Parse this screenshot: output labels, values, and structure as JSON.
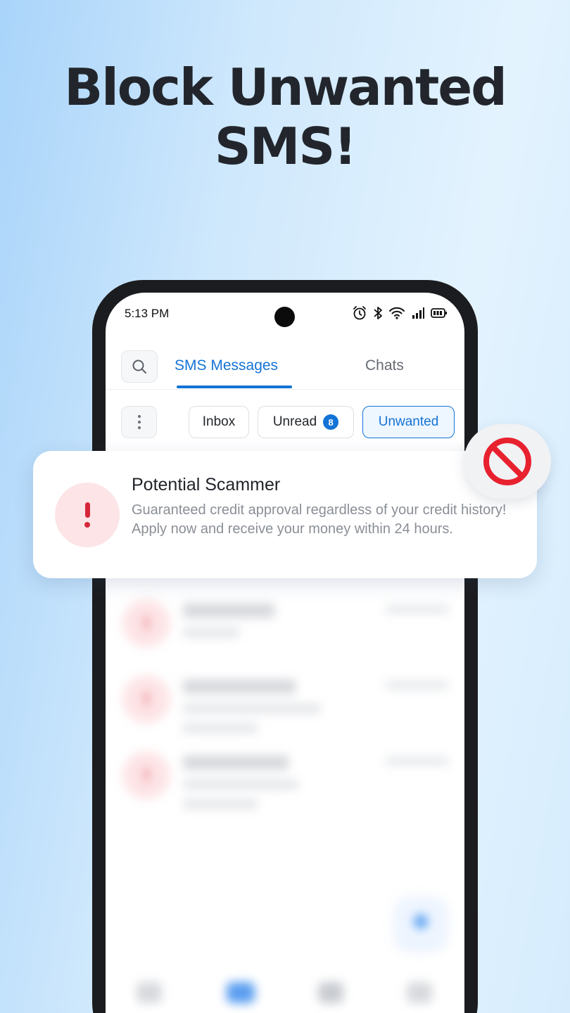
{
  "headline": {
    "line1": "Block Unwanted",
    "line2": "SMS!"
  },
  "status_bar": {
    "time": "5:13 PM",
    "icons": [
      "alarm-icon",
      "bluetooth-icon",
      "wifi-icon",
      "signal-icon",
      "battery-icon"
    ]
  },
  "header": {
    "tabs": [
      {
        "label": "SMS Messages",
        "active": true
      },
      {
        "label": "Chats",
        "active": false
      }
    ]
  },
  "filters": {
    "chips": [
      {
        "label": "Inbox",
        "active": false
      },
      {
        "label": "Unread",
        "badge": "8",
        "active": false
      },
      {
        "label": "Unwanted",
        "active": true
      }
    ]
  },
  "notification": {
    "title": "Potential Scammer",
    "body": "Guaranteed credit approval regardless of your credit history! Apply now and receive your money within 24 hours.",
    "block_icon": "no-entry-icon"
  },
  "colors": {
    "accent": "#1473d6",
    "danger": "#d6273a",
    "danger_bg": "#fde4e6"
  }
}
